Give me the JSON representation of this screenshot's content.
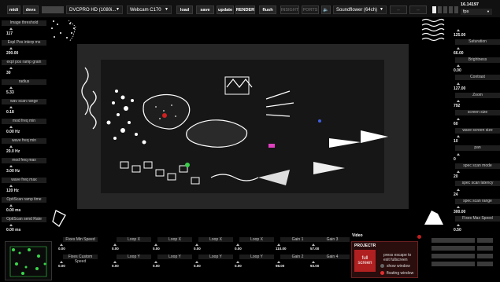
{
  "toolbar": {
    "midi": "midi",
    "devs": "devs",
    "video_source": "DVCPRO HD (1080i...",
    "camera": "Webcam C170",
    "load": "load",
    "save": "save",
    "update": "update",
    "render": "RENDER",
    "flush": "flush",
    "dim_a": "INSIGHT",
    "dim_b": "PORTS",
    "speaker": "🔈",
    "audio_out": "Soundflower (64ch)",
    "dim_c": "--",
    "dim_d": "--",
    "fps_value": "16.14197",
    "fps_label": "fps"
  },
  "left_params": [
    {
      "label": "Image threshold",
      "value": "117"
    },
    {
      "label": "Expl Pos interp ms",
      "value": "200.00"
    },
    {
      "label": "expl pos ramp grain",
      "value": "30"
    },
    {
      "label": "radius",
      "value": "5.33"
    },
    {
      "label": "wav scan range",
      "value": "0.18"
    },
    {
      "label": "mod freq min",
      "value": "0.00 Hz"
    },
    {
      "label": "wave freq min",
      "value": "20.0 Hz"
    },
    {
      "label": "mod freq max",
      "value": "3.00 Hz"
    },
    {
      "label": "wave freq max",
      "value": "120 Hz"
    },
    {
      "label": "OptiScan ramp time",
      "value": "0.00 ms"
    },
    {
      "label": "OptiScan send Rate",
      "value": "0.00 ms"
    }
  ],
  "right_params": [
    {
      "label": "Saturation",
      "value": "125.00"
    },
    {
      "label": "Brightness",
      "value": "66.00"
    },
    {
      "label": "Contrast",
      "value": "0.00"
    },
    {
      "label": "Zoom",
      "value": "127.00"
    },
    {
      "label": "screen size",
      "value": "792"
    },
    {
      "label": "wave screen size",
      "value": "60"
    },
    {
      "label": "pan",
      "value": "10"
    },
    {
      "label": "spec scan mode",
      "value": "0"
    },
    {
      "label": "spec scan latency",
      "value": "20"
    },
    {
      "label": "spec scan range",
      "value": "24"
    },
    {
      "label": "Fixes Max Speed",
      "value": "300.00"
    },
    {
      "label": "Fixes Opti Thres",
      "value": "0.50"
    }
  ],
  "bottom_params": [
    {
      "label": "Fixes Min Speed",
      "value": "0.00"
    },
    {
      "label": "Fixes Custom Speed",
      "value": "0.00"
    },
    {
      "label": "Loop X",
      "value": "0.00"
    },
    {
      "label": "Loop Y",
      "value": "0.00"
    },
    {
      "label": "Loop X",
      "value": "0.00"
    },
    {
      "label": "Loop Y",
      "value": "0.00"
    },
    {
      "label": "Loop X",
      "value": "0.00"
    },
    {
      "label": "Loop Y",
      "value": "0.00"
    },
    {
      "label": "Loop X",
      "value": "0.00"
    },
    {
      "label": "Loop Y",
      "value": "0.00"
    },
    {
      "label": "Gain 1",
      "value": "110.00"
    },
    {
      "label": "Gain 2",
      "value": "98.00"
    },
    {
      "label": "Gain 3",
      "value": "57.00"
    },
    {
      "label": "Gain 4",
      "value": "93.00"
    }
  ],
  "projector": {
    "video_label": "Video",
    "title": "PROJECTR",
    "full_screen": "full screen",
    "hint": "press escape to exit fullscreen",
    "show_window": "show window",
    "floating_window": "floating window"
  },
  "colors": {
    "accent_red": "#b02020",
    "led_red": "#e03030",
    "thumb_green": "#39d84a"
  }
}
